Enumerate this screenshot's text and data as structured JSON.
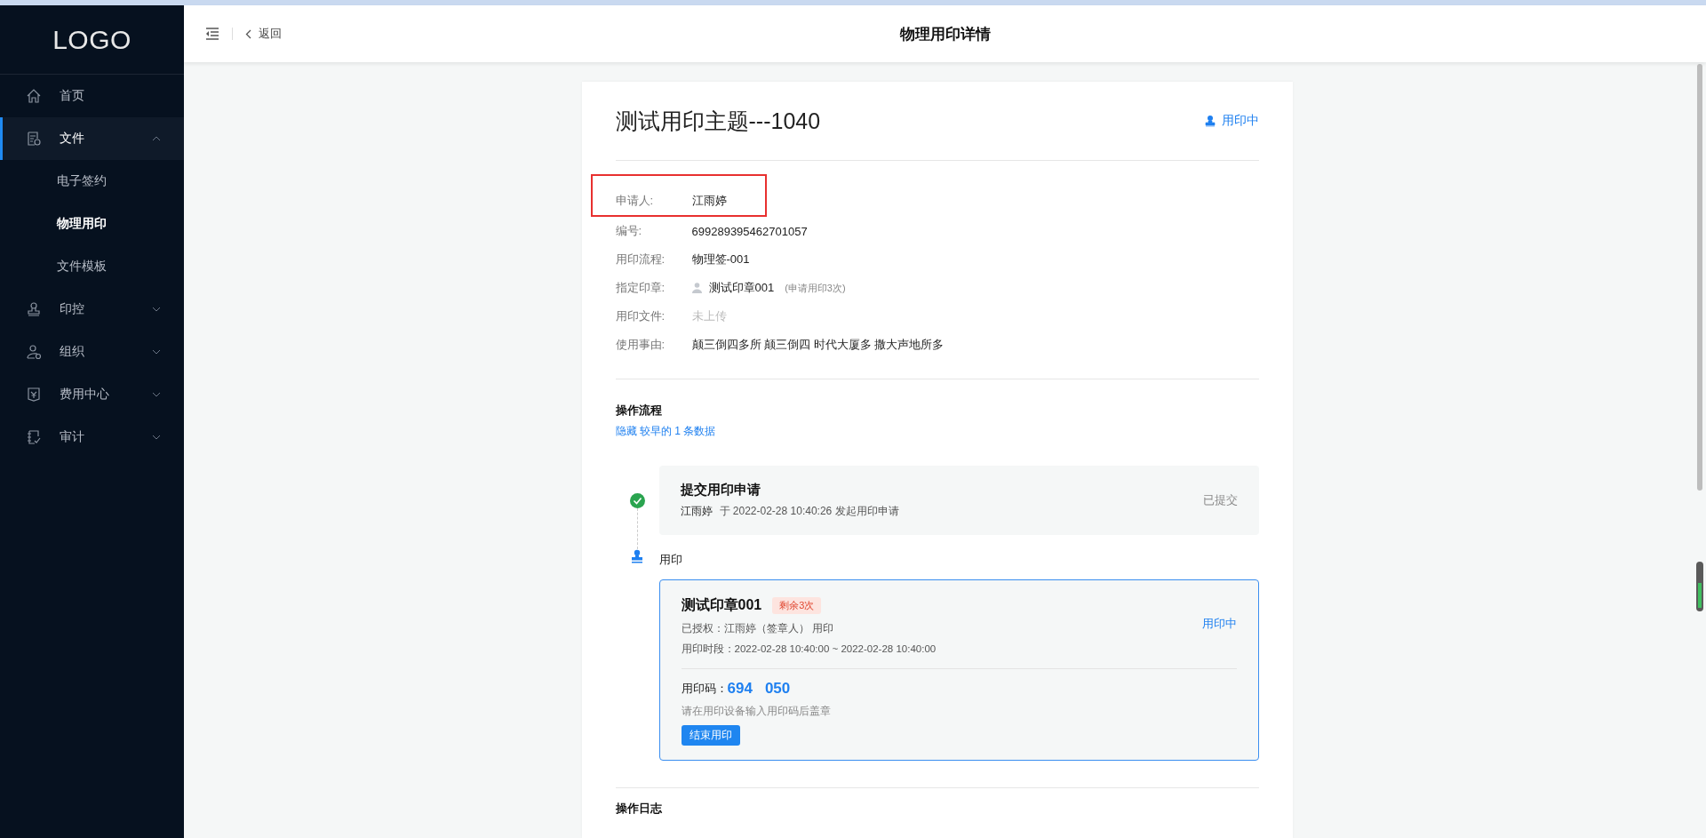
{
  "sidebar": {
    "logo": "LOGO",
    "items": [
      {
        "label": "首页",
        "kind": "link",
        "selected": false
      },
      {
        "label": "文件",
        "kind": "group",
        "expanded": true,
        "selected": true,
        "children": [
          {
            "label": "电子签约",
            "selected": false
          },
          {
            "label": "物理用印",
            "selected": true
          },
          {
            "label": "文件模板",
            "selected": false
          }
        ]
      },
      {
        "label": "印控",
        "kind": "group",
        "expanded": false,
        "selected": false
      },
      {
        "label": "组织",
        "kind": "group",
        "expanded": false,
        "selected": false
      },
      {
        "label": "费用中心",
        "kind": "group",
        "expanded": false,
        "selected": false
      },
      {
        "label": "审计",
        "kind": "group",
        "expanded": false,
        "selected": false
      }
    ]
  },
  "header": {
    "back": "返回",
    "title": "物理用印详情"
  },
  "detail": {
    "title": "测试用印主题---1040",
    "status": "用印中",
    "fields": [
      {
        "label": "申请人:",
        "value": "江雨婷",
        "kind": "text",
        "highlighted": true
      },
      {
        "label": "编号:",
        "value": "699289395462701057",
        "kind": "text",
        "highlighted": false
      },
      {
        "label": "用印流程:",
        "value": "物理签-001",
        "kind": "text",
        "highlighted": false
      },
      {
        "label": "指定印章:",
        "value": "测试印章001",
        "note": "(申请用印3次)",
        "kind": "seal",
        "highlighted": false
      },
      {
        "label": "用印文件:",
        "value": "未上传",
        "kind": "muted",
        "highlighted": false
      },
      {
        "label": "使用事由:",
        "value": "颠三倒四多所 颠三倒四 时代大厦多 撒大声地所多",
        "kind": "text",
        "highlighted": false
      }
    ],
    "flow": {
      "title": "操作流程",
      "toggle": "隐藏 较早的 1 条数据",
      "steps": [
        {
          "kind": "submitted",
          "title": "提交用印申请",
          "actor": "江雨婷",
          "text": "于 2022-02-28 10:40:26 发起用印申请",
          "status": "已提交"
        },
        {
          "kind": "seal",
          "label": "用印",
          "seal_name": "测试印章001",
          "badge": "剩余3次",
          "status": "用印中",
          "authorized": "已授权：江雨婷（签章人） 用印",
          "period": "用印时段：2022-02-28 10:40:00 ~ 2022-02-28 10:40:00",
          "code_label": "用印码：",
          "code_groups": [
            "694",
            "050"
          ],
          "hint": "请在用印设备输入用印码后盖章",
          "button": "结束用印"
        }
      ]
    },
    "log_title": "操作日志"
  }
}
